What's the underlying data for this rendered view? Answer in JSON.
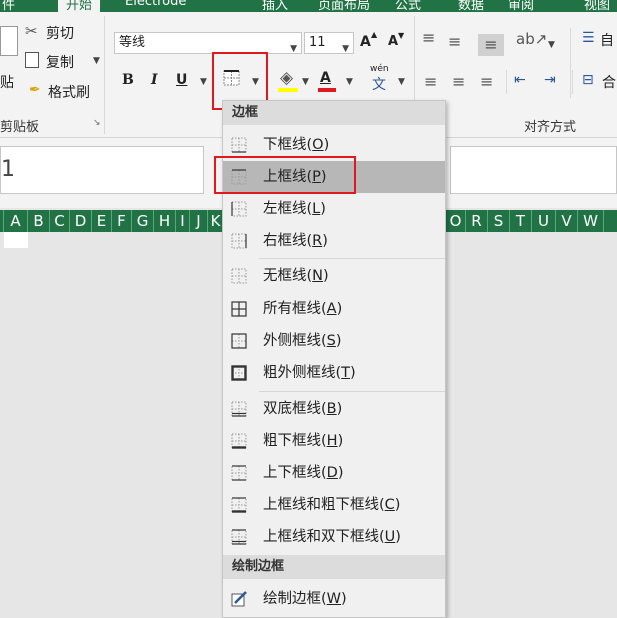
{
  "topbar": {
    "tabs": [
      "件",
      "开始",
      "Electrode",
      "插入",
      "页面布局",
      "公式",
      "数据",
      "审阅",
      "视图"
    ]
  },
  "clipboard": {
    "cut": "剪切",
    "copy": "复制",
    "format_painter": "格式刷",
    "paste": "贴",
    "group": "剪贴板"
  },
  "font": {
    "name": "等线",
    "size": "11",
    "bold": "B",
    "italic": "I",
    "underline": "U",
    "grow": "A",
    "shrink": "A",
    "font_color": "A",
    "phonetic": "wén",
    "phonetic_char": "文"
  },
  "alignment": {
    "group": "对齐方式",
    "wrap_partial": "自",
    "merge_partial": "合"
  },
  "formula_bar": {
    "cell_ref": "1"
  },
  "columns": [
    "A",
    "B",
    "C",
    "D",
    "E",
    "F",
    "G",
    "H",
    "I",
    "J",
    "K",
    "L",
    "M",
    "N",
    "O",
    "P",
    "Q",
    "R",
    "S",
    "T",
    "U",
    "V",
    "W"
  ],
  "menu": {
    "header": "边框",
    "items": [
      {
        "label": "下框线",
        "key": "O",
        "icon": "bottom-border-icon"
      },
      {
        "label": "上框线",
        "key": "P",
        "icon": "top-border-icon",
        "selected": true
      },
      {
        "label": "左框线",
        "key": "L",
        "icon": "left-border-icon"
      },
      {
        "label": "右框线",
        "key": "R",
        "icon": "right-border-icon"
      },
      {
        "label": "无框线",
        "key": "N",
        "icon": "no-border-icon"
      },
      {
        "label": "所有框线",
        "key": "A",
        "icon": "all-borders-icon"
      },
      {
        "label": "外侧框线",
        "key": "S",
        "icon": "outside-borders-icon"
      },
      {
        "label": "粗外侧框线",
        "key": "T",
        "icon": "thick-outside-borders-icon"
      },
      {
        "label": "双底框线",
        "key": "B",
        "icon": "double-bottom-border-icon"
      },
      {
        "label": "粗下框线",
        "key": "H",
        "icon": "thick-bottom-border-icon"
      },
      {
        "label": "上下框线",
        "key": "D",
        "icon": "top-bottom-border-icon"
      },
      {
        "label": "上框线和粗下框线",
        "key": "C",
        "icon": "top-thick-bottom-border-icon"
      },
      {
        "label": "上框线和双下框线",
        "key": "U",
        "icon": "top-double-bottom-border-icon"
      }
    ],
    "draw_header": "绘制边框",
    "draw_item": {
      "label": "绘制边框",
      "key": "W",
      "icon": "draw-border-icon"
    }
  },
  "colors": {
    "excel_green": "#217346",
    "highlight_red": "#e0191f",
    "selected_row": "#b7b7b7"
  }
}
